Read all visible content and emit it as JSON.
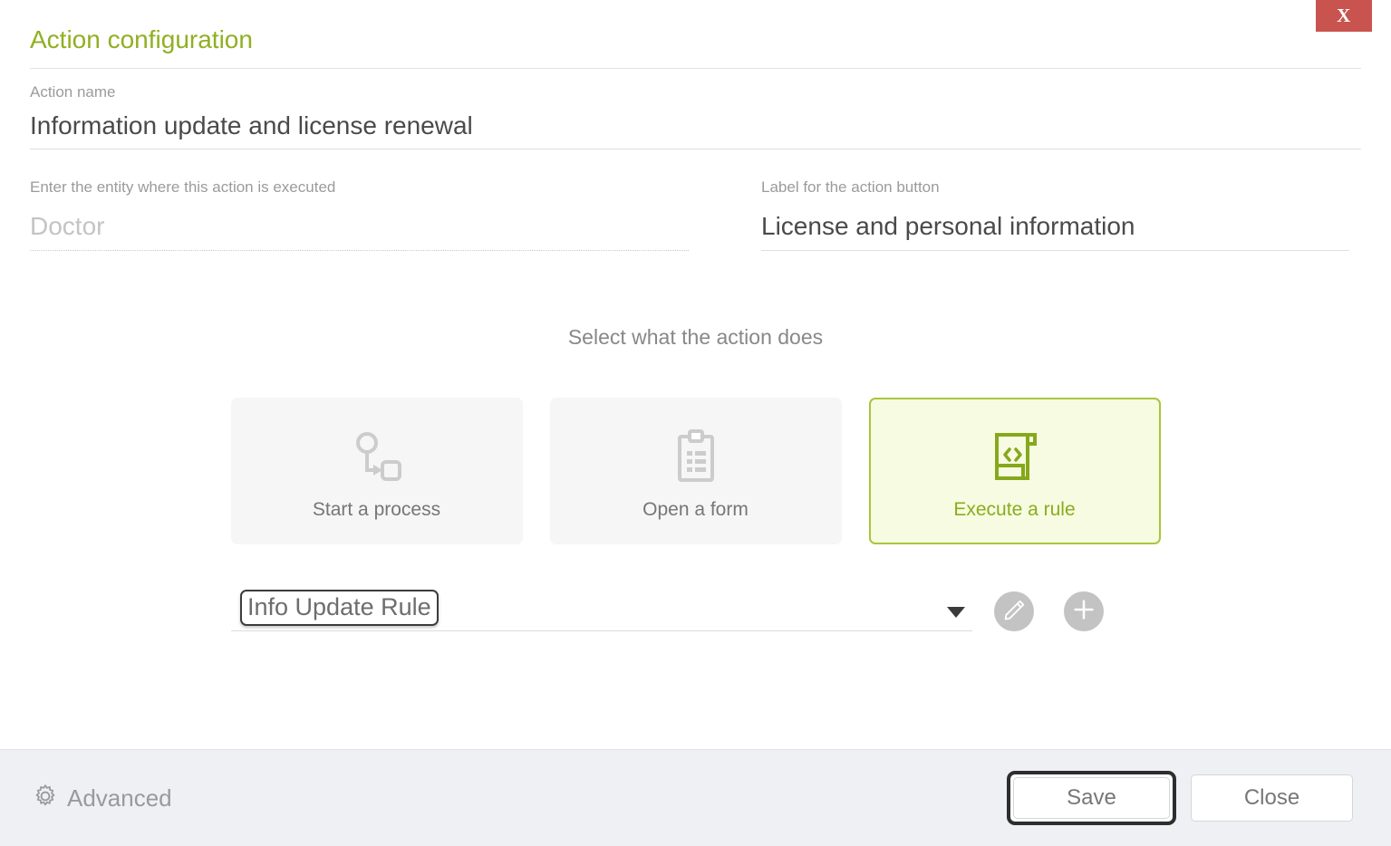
{
  "dialog": {
    "title": "Action configuration",
    "close_label": "X"
  },
  "fields": {
    "action_name": {
      "label": "Action name",
      "value": "Information update and license renewal"
    },
    "entity": {
      "label": "Enter the entity where this action is executed",
      "value": "Doctor",
      "placeholder": "Doctor"
    },
    "button_label": {
      "label": "Label for the action button",
      "value": "License and personal information"
    }
  },
  "selector": {
    "heading": "Select what the action does",
    "cards": [
      {
        "label": "Start a process",
        "icon": "process-flow-icon",
        "selected": false
      },
      {
        "label": "Open a form",
        "icon": "clipboard-icon",
        "selected": false
      },
      {
        "label": "Execute a rule",
        "icon": "code-document-icon",
        "selected": true
      }
    ]
  },
  "rule": {
    "selected_value": "Info Update Rule",
    "dropdown_icon": "chevron-down-icon",
    "edit_icon": "pencil-icon",
    "add_icon": "plus-icon"
  },
  "footer": {
    "advanced_label": "Advanced",
    "advanced_icon": "gear-icon",
    "save_label": "Save",
    "close_label": "Close"
  },
  "colors": {
    "accent_green": "#8fb021",
    "selected_card_bg": "#f7fbe1",
    "selected_card_border": "#a8c63c",
    "close_red": "#c9534f",
    "footer_bg": "#eff0f4"
  }
}
